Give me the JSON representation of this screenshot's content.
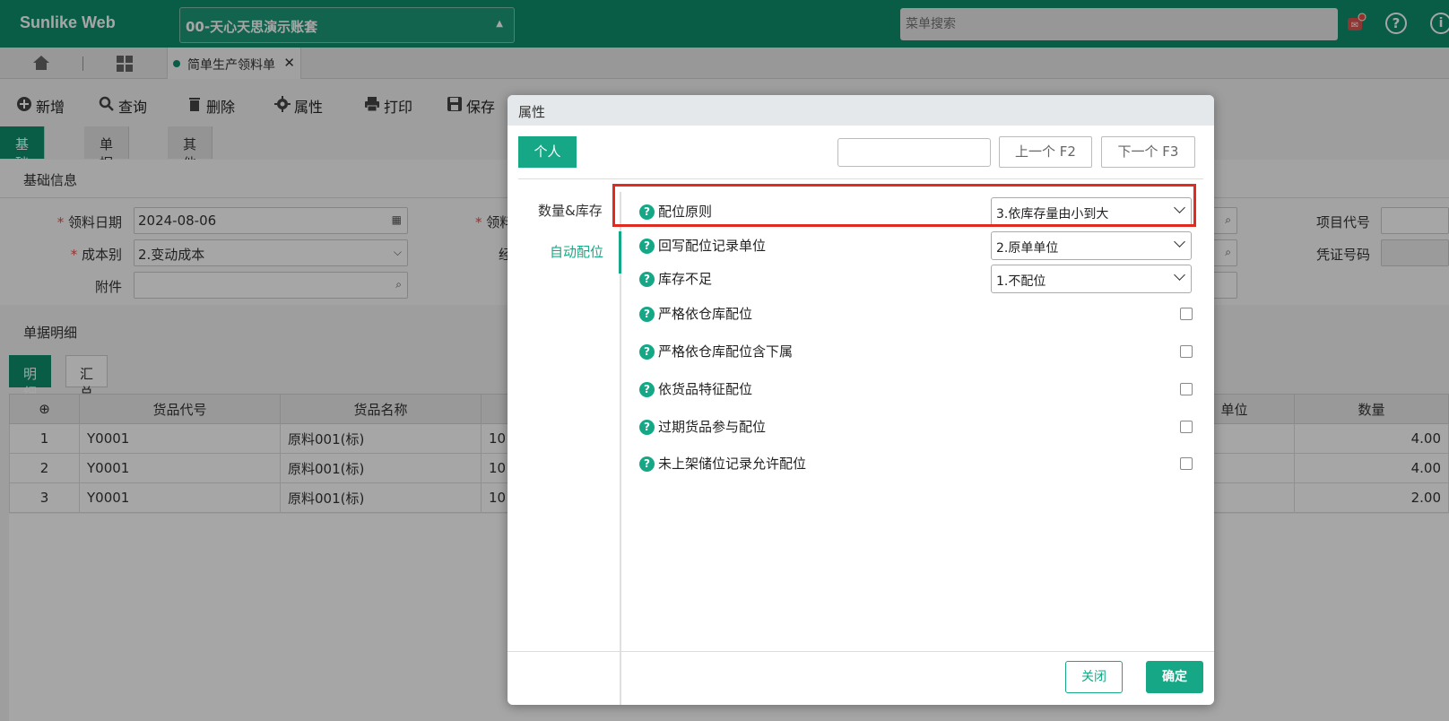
{
  "app": {
    "brand": "Sunlike Web",
    "account": "00-天心天思演示账套",
    "search_placeholder": "菜单搜索"
  },
  "tabs": {
    "doc_tab": "简单生产领料单"
  },
  "toolbar": {
    "new": "新增",
    "query": "查询",
    "delete": "删除",
    "properties": "属性",
    "print": "打印",
    "save": "保存"
  },
  "sections": [
    "基础信息",
    "单据明细",
    "其他"
  ],
  "basic": {
    "title": "基础信息",
    "date_label": "领料日期",
    "date_value": "2024-08-06",
    "cost_label": "成本别",
    "cost_value": "2.变动成本",
    "attach_label": "附件",
    "label_2": "领料",
    "label_3": "经",
    "project_label": "项目代号",
    "voucher_label": "凭证号码"
  },
  "detail": {
    "title": "单据明细",
    "tabs": [
      "明细",
      "汇总"
    ],
    "columns": [
      "货品代号",
      "货品名称",
      "单位",
      "数量"
    ],
    "rows": [
      {
        "no": "1",
        "code": "Y0001",
        "name": "原料001(标)",
        "partial": "10",
        "qty": "4.00"
      },
      {
        "no": "2",
        "code": "Y0001",
        "name": "原料001(标)",
        "partial": "10",
        "qty": "4.00"
      },
      {
        "no": "3",
        "code": "Y0001",
        "name": "原料001(标)",
        "partial": "10",
        "qty": "2.00"
      }
    ]
  },
  "dialog": {
    "title": "属性",
    "personal": "个人",
    "prev": "上一个 F2",
    "next": "下一个 F3",
    "sidebar": [
      "数量&库存",
      "自动配位"
    ],
    "rows": [
      {
        "label": "配位原则",
        "value": "3.依库存量由小到大"
      },
      {
        "label": "回写配位记录单位",
        "value": "2.原单单位"
      },
      {
        "label": "库存不足",
        "value": "1.不配位"
      },
      {
        "label": "严格依仓库配位"
      },
      {
        "label": "严格依仓库配位含下属"
      },
      {
        "label": "依货品特征配位"
      },
      {
        "label": "过期货品参与配位"
      },
      {
        "label": "未上架储位记录允许配位"
      }
    ],
    "close": "关闭",
    "ok": "确定"
  },
  "colors": {
    "primary": "#0e8f6e",
    "accent": "#16a886",
    "highlight": "#e02b20"
  }
}
